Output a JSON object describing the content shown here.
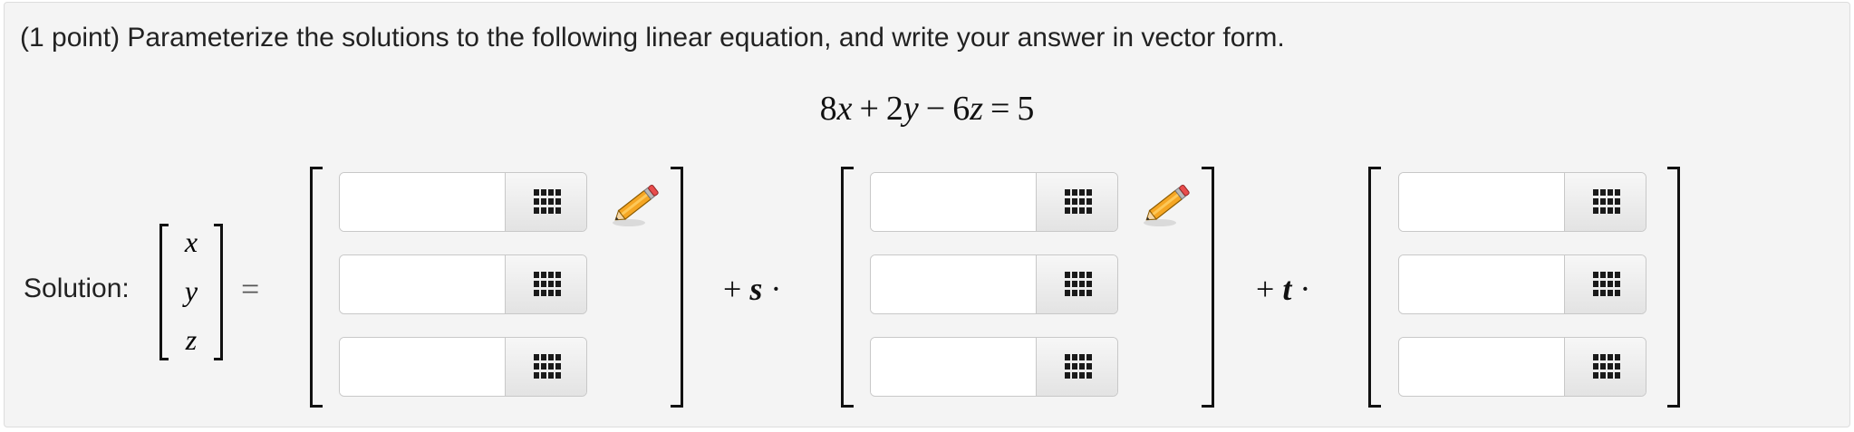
{
  "problem": {
    "prompt": "(1 point) Parameterize the solutions to the following linear equation, and write your answer in vector form.",
    "equation": {
      "c1": "8",
      "v1": "x",
      "op1": "+",
      "c2": "2",
      "v2": "y",
      "op2": "−",
      "c3": "6",
      "v3": "z",
      "eq": "=",
      "rhs": "5"
    }
  },
  "solution": {
    "label": "Solution:",
    "vars": [
      "x",
      "y",
      "z"
    ],
    "equals": "=",
    "plus_s": "+",
    "param_s": "s",
    "dot_s": "·",
    "plus_t": "+",
    "param_t": "t",
    "dot_t": "·"
  },
  "inputs": {
    "v0": [
      "",
      "",
      ""
    ],
    "v1": [
      "",
      "",
      ""
    ],
    "v2": [
      "",
      "",
      ""
    ]
  },
  "icons": {
    "palette": "grid-icon",
    "edit": "pencil-icon"
  },
  "colors": {
    "panel_bg": "#f4f4f4",
    "pencil_body": "#f5a623",
    "pencil_eraser": "#e84c4c"
  }
}
